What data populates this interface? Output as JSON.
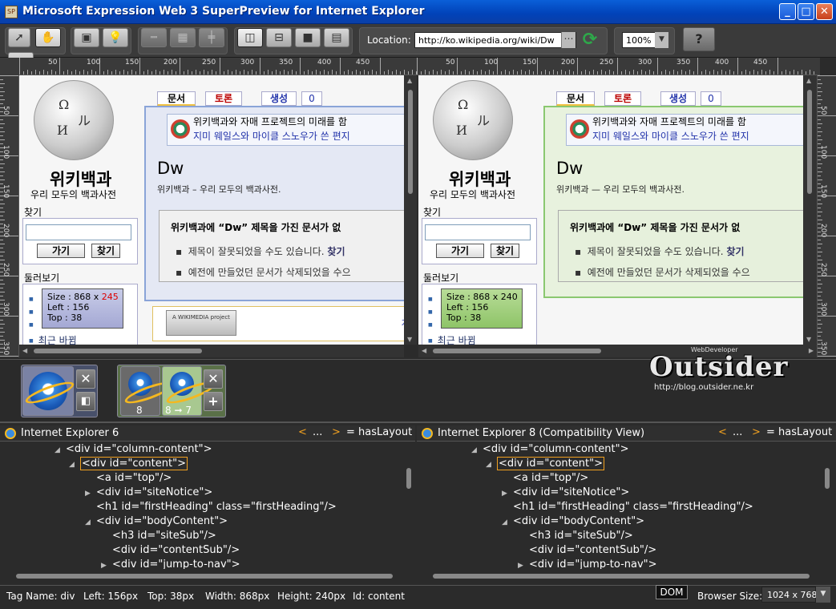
{
  "window": {
    "title": "Microsoft Expression Web 3 SuperPreview for Internet Explorer",
    "controls": [
      "_",
      "□",
      "✕"
    ]
  },
  "toolbar": {
    "location_label": "Location:",
    "location_value": "http://ko.wikipedia.org/wiki/Dw",
    "zoom_value": "100%",
    "help_label": "?"
  },
  "rulers": {
    "h_labels": [
      "50",
      "100",
      "150",
      "200",
      "250",
      "300",
      "350",
      "400",
      "450"
    ],
    "v_labels": [
      "50",
      "100",
      "150",
      "200",
      "250",
      "300",
      "350"
    ]
  },
  "page_left": {
    "wiki_title": "위키백과",
    "wiki_subtitle": "우리 모두의 백과사전",
    "search_heading": "찾기",
    "go_button": "가기",
    "search_button": "찾기",
    "nav_heading": "둘러보기",
    "tabs": [
      "문서",
      "토론",
      "생성",
      "0"
    ],
    "notice_line1": "위키백과와 자매 프로젝트의 미래를 함",
    "notice_line2": "지미 웨일스와 마이클 스노우가 쓴 편지",
    "heading": "Dw",
    "sitesub": "위키백과 – 우리 모두의 백과사전.",
    "nores_title": "위키백과에 “Dw” 제목을 가진 문서가 없",
    "nores_item1": "제목이 잘못되었을 수도 있습니다.",
    "nores_item1_link": "찾기",
    "nores_item2": "예전에 만들었던 문서가 삭제되었을 수으",
    "footer_badge": "A WIKIMEDIA project",
    "footer_link": "개인",
    "recent_changes": "최근 바뀜",
    "tip_size_label": "Size : 868 x ",
    "tip_size_h": "245",
    "tip_left": "Left : 156",
    "tip_top": "Top : 38"
  },
  "page_right": {
    "wiki_title": "위키백과",
    "wiki_subtitle": "우리 모두의 백과사전",
    "search_heading": "찾기",
    "go_button": "가기",
    "search_button": "찾기",
    "nav_heading": "둘러보기",
    "tabs": [
      "문서",
      "토론",
      "생성",
      "0"
    ],
    "notice_line1": "위키백과와 자매 프로젝트의 미래를 함",
    "notice_line2": "지미 웨일스와 마이클 스노우가 쓴 편지",
    "heading": "Dw",
    "sitesub": "위키백과 — 우리 모두의 백과사전.",
    "nores_title": "위키백과에 “Dw” 제목을 가진 문서가 없",
    "nores_item1": "제목이 잘못되었을 수도 있습니다.",
    "nores_item1_link": "찾기",
    "nores_item2": "예전에 만들었던 문서가 삭제되었을 수으",
    "recent_changes": "최근 바뀜",
    "tip_size": "Size : 868 x 240",
    "tip_left": "Left : 156",
    "tip_top": "Top : 38"
  },
  "browsers": {
    "baseline_close": "✕",
    "baseline_layout": "◧",
    "compare_version_a": "8",
    "compare_version_b": "8 ➞ 7",
    "compare_close": "✕",
    "compare_add": "+"
  },
  "watermark": {
    "tagline": "WebDeveloper",
    "brand": "Outsider",
    "url": "http://blog.outsider.ne.kr"
  },
  "dom_left": {
    "browser_name": "Internet Explorer 6",
    "nav_prev": "<",
    "nav_dots": "...",
    "nav_next": ">",
    "haslayout": "= hasLayout",
    "nodes": [
      {
        "text_pre": "<div id=\"",
        "id": "column-content",
        "text_post": "\">"
      },
      {
        "text_pre": "<div id=\"",
        "id": "content",
        "text_post": "\">"
      },
      {
        "text_pre": "<a id=\"",
        "id": "top",
        "text_post": "\"/>"
      },
      {
        "text_pre": "<div id=\"",
        "id": "siteNotice",
        "text_post": "\">"
      },
      {
        "text_pre": "<h1 id=\"",
        "id": "firstHeading",
        "text_post": "\" class=\"firstHeading\"/>"
      },
      {
        "text_pre": "<div id=\"",
        "id": "bodyContent",
        "text_post": "\">"
      },
      {
        "text_pre": "<h3 id=\"",
        "id": "siteSub",
        "text_post": "\"/>"
      },
      {
        "text_pre": "<div id=\"",
        "id": "contentSub",
        "text_post": "\"/>"
      },
      {
        "text_pre": "<div id=\"",
        "id": "jump-to-nav",
        "text_post": "\">"
      }
    ]
  },
  "dom_right": {
    "browser_name": "Internet Explorer 8 (Compatibility View)",
    "nav_prev": "<",
    "nav_dots": "...",
    "nav_next": ">",
    "haslayout": "= hasLayout",
    "nodes": [
      {
        "text_pre": "<div id=\"",
        "id": "column-content",
        "text_post": "\">"
      },
      {
        "text_pre": "<div id=\"",
        "id": "content",
        "text_post": "\">"
      },
      {
        "text_pre": "<a id=\"",
        "id": "top",
        "text_post": "\"/>"
      },
      {
        "text_pre": "<div id=\"",
        "id": "siteNotice",
        "text_post": "\">"
      },
      {
        "text_pre": "<h1 id=\"",
        "id": "firstHeading",
        "text_post": "\" class=\"firstHeading\"/>"
      },
      {
        "text_pre": "<div id=\"",
        "id": "bodyContent",
        "text_post": "\">"
      },
      {
        "text_pre": "<h3 id=\"",
        "id": "siteSub",
        "text_post": "\"/>"
      },
      {
        "text_pre": "<div id=\"",
        "id": "contentSub",
        "text_post": "\"/>"
      },
      {
        "text_pre": "<div id=\"",
        "id": "jump-to-nav",
        "text_post": "\">"
      }
    ]
  },
  "status": {
    "tag_name": "Tag Name: div",
    "left": "Left: 156px",
    "top": "Top: 38px",
    "width": "Width: 868px",
    "height": "Height: 240px",
    "id": "Id: content",
    "dom_button": "DOM",
    "browser_size_label": "Browser Size:",
    "browser_size_value": "1024 x 768"
  }
}
